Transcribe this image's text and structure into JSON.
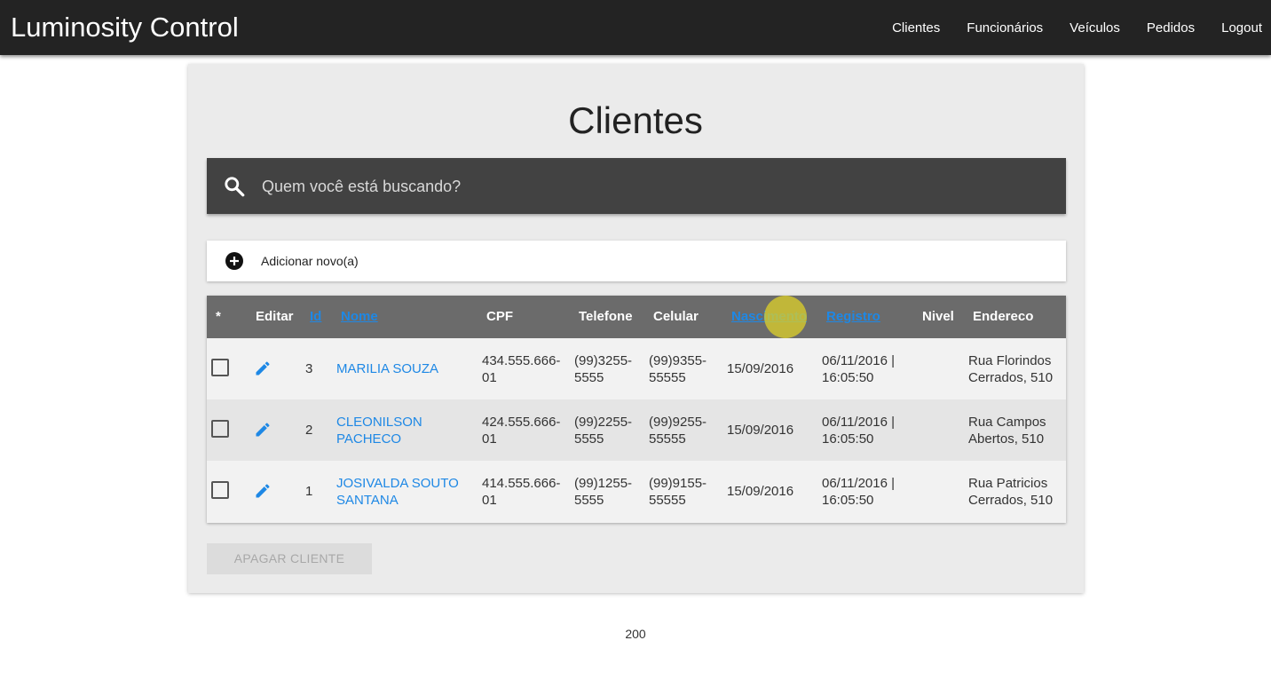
{
  "header": {
    "brand": "Luminosity Control",
    "nav": [
      "Clientes",
      "Funcionários",
      "Veículos",
      "Pedidos",
      "Logout"
    ]
  },
  "page": {
    "title": "Clientes"
  },
  "search": {
    "placeholder": "Quem você está buscando?",
    "value": ""
  },
  "add_new": {
    "label": "Adicionar novo(a)"
  },
  "table": {
    "columns": {
      "select": "*",
      "edit": "Editar",
      "id": "Id",
      "nome": "Nome",
      "cpf": "CPF",
      "telefone": "Telefone",
      "celular": "Celular",
      "nascimento": "Nascimento",
      "registro": "Registro",
      "nivel": "Nivel",
      "endereco": "Endereco"
    },
    "rows": [
      {
        "id": "3",
        "nome": [
          "MARILIA SOUZA"
        ],
        "cpf": [
          "434.555.666-",
          "01"
        ],
        "telefone": [
          "(99)3255-",
          "5555"
        ],
        "celular": [
          "(99)9355-",
          "55555"
        ],
        "nascimento": "15/09/2016",
        "registro": [
          "06/11/2016 |",
          "16:05:50"
        ],
        "nivel": "",
        "endereco": [
          "Rua Florindos",
          "Cerrados, 510"
        ]
      },
      {
        "id": "2",
        "nome": [
          "CLEONILSON",
          "PACHECO"
        ],
        "cpf": [
          "424.555.666-",
          "01"
        ],
        "telefone": [
          "(99)2255-",
          "5555"
        ],
        "celular": [
          "(99)9255-",
          "55555"
        ],
        "nascimento": "15/09/2016",
        "registro": [
          "06/11/2016 |",
          "16:05:50"
        ],
        "nivel": "",
        "endereco": [
          "Rua Campos",
          "Abertos, 510"
        ]
      },
      {
        "id": "1",
        "nome": [
          "JOSIVALDA SOUTO",
          "SANTANA"
        ],
        "cpf": [
          "414.555.666-",
          "01"
        ],
        "telefone": [
          "(99)1255-",
          "5555"
        ],
        "celular": [
          "(99)9155-",
          "55555"
        ],
        "nascimento": "15/09/2016",
        "registro": [
          "06/11/2016 |",
          "16:05:50"
        ],
        "nivel": "",
        "endereco": [
          "Rua Patricios",
          "Cerrados, 510"
        ]
      }
    ]
  },
  "actions": {
    "delete_label": "APAGAR CLIENTE"
  },
  "footer": {
    "text": "200"
  },
  "icons": {
    "search": "search-icon",
    "add": "add-circle-icon",
    "edit": "pencil-icon",
    "checkbox": "checkbox-unchecked"
  },
  "colors": {
    "topbar": "#232323",
    "searchbar": "#424242",
    "table_header": "#6b6b6b",
    "link": "#1e88e5",
    "cursor_highlight": "#ded028"
  }
}
